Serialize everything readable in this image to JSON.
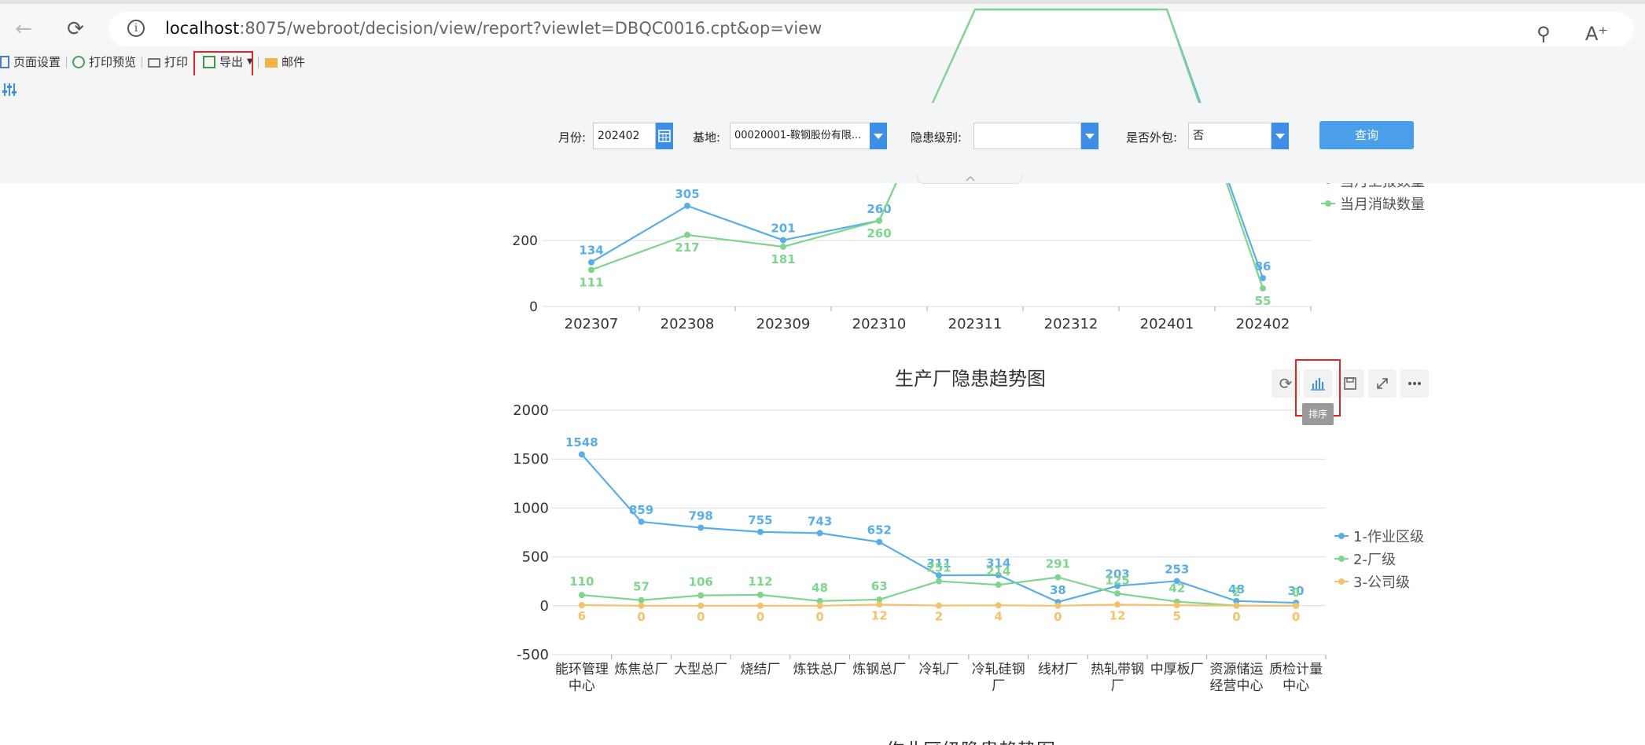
{
  "browser": {
    "url_host": "localhost",
    "url_rest": ":8075/webroot/decision/view/report?viewlet=DBQC0016.cpt&op=view"
  },
  "toolbar": {
    "page_setup": "页面设置",
    "print_preview": "打印预览",
    "print": "打印",
    "export": "导出",
    "mail": "邮件"
  },
  "params": {
    "month_label": "月份:",
    "month_value": "202402",
    "base_label": "基地:",
    "base_value": "00020001-鞍钢股份有限...",
    "level_label": "隐患级别:",
    "level_value": "",
    "outsourced_label": "是否外包:",
    "outsourced_value": "否",
    "query_label": "查询"
  },
  "tooltip": "排序",
  "chart_data": [
    {
      "type": "line",
      "title": "",
      "categories": [
        "202307",
        "202308",
        "202309",
        "202310",
        "202311",
        "202312",
        "202401",
        "202402"
      ],
      "series": [
        {
          "name": "当月上报数量",
          "values": [
            134,
            305,
            201,
            260,
            null,
            null,
            null,
            86
          ],
          "color": "#5aaee8"
        },
        {
          "name": "当月消缺数量",
          "values": [
            111,
            217,
            181,
            260,
            null,
            null,
            null,
            55
          ],
          "color": "#7ed58c"
        }
      ],
      "legend_visible": [
        "当月上报数量",
        "当月消缺数量"
      ],
      "yticks": [
        0,
        200
      ],
      "grid": true,
      "legend": "right"
    },
    {
      "type": "line",
      "title": "生产厂隐患趋势图",
      "categories": [
        "能环管理中心",
        "炼焦总厂",
        "大型总厂",
        "烧结厂",
        "炼铁总厂",
        "炼钢总厂",
        "冷轧厂",
        "冷轧硅钢厂",
        "线材厂",
        "热轧带钢厂",
        "中厚板厂",
        "资源储运经营中心",
        "质检计量中心"
      ],
      "category_lines": [
        [
          "能环管理",
          "中心"
        ],
        [
          "炼焦总厂"
        ],
        [
          "大型总厂"
        ],
        [
          "烧结厂"
        ],
        [
          "炼铁总厂"
        ],
        [
          "炼钢总厂"
        ],
        [
          "冷轧厂"
        ],
        [
          "冷轧硅钢",
          "厂"
        ],
        [
          "线材厂"
        ],
        [
          "热轧带钢",
          "厂"
        ],
        [
          "中厚板厂"
        ],
        [
          "资源储运",
          "经营中心"
        ],
        [
          "质检计量",
          "中心"
        ]
      ],
      "series": [
        {
          "name": "1-作业区级",
          "values": [
            1548,
            859,
            798,
            755,
            743,
            652,
            311,
            314,
            38,
            203,
            253,
            48,
            30
          ],
          "color": "#5aaee8"
        },
        {
          "name": "2-厂级",
          "values": [
            110,
            57,
            106,
            112,
            48,
            63,
            251,
            214,
            291,
            125,
            42,
            2,
            0
          ],
          "color": "#7ed58c"
        },
        {
          "name": "3-公司级",
          "values": [
            6,
            0,
            0,
            0,
            0,
            12,
            2,
            4,
            0,
            12,
            5,
            0,
            0
          ],
          "color": "#f5c26b"
        }
      ],
      "ylim": [
        -500,
        2000
      ],
      "yticks": [
        -500,
        0,
        500,
        1000,
        1500,
        2000
      ],
      "grid": true,
      "legend": "right"
    }
  ],
  "next_chart_title_partial": "作业区级隐患趋势图"
}
